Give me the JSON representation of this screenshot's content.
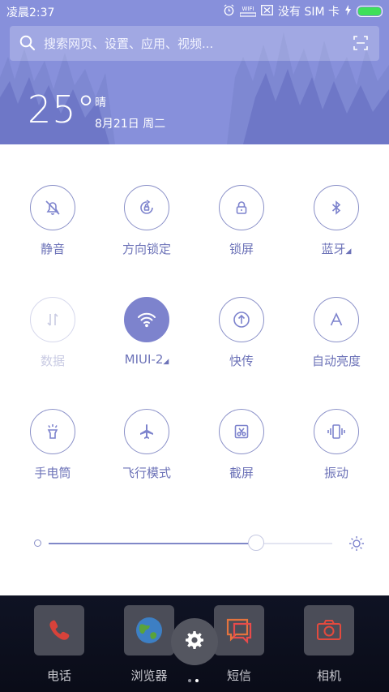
{
  "status_bar": {
    "time": "凌晨2:37",
    "wifi_label": "WIFI",
    "sim_text": "没有 SIM 卡"
  },
  "search": {
    "placeholder": "搜索网页、设置、应用、视频..."
  },
  "weather": {
    "temperature": "25°",
    "condition": "晴",
    "date": "8月21日 周二"
  },
  "toggles": [
    {
      "label": "静音",
      "icon": "silent-bell-icon",
      "state": "off"
    },
    {
      "label": "方向锁定",
      "icon": "rotation-lock-icon",
      "state": "off"
    },
    {
      "label": "锁屏",
      "icon": "lock-icon",
      "state": "off"
    },
    {
      "label": "蓝牙",
      "icon": "bluetooth-icon",
      "state": "off"
    },
    {
      "label": "数据",
      "icon": "mobile-data-icon",
      "state": "disabled"
    },
    {
      "label": "MIUI-2",
      "icon": "wifi-icon",
      "state": "on"
    },
    {
      "label": "快传",
      "icon": "quick-transfer-icon",
      "state": "off"
    },
    {
      "label": "自动亮度",
      "icon": "auto-brightness-icon",
      "state": "off"
    },
    {
      "label": "手电筒",
      "icon": "flashlight-icon",
      "state": "off"
    },
    {
      "label": "飞行模式",
      "icon": "airplane-icon",
      "state": "off"
    },
    {
      "label": "截屏",
      "icon": "screenshot-icon",
      "state": "off"
    },
    {
      "label": "振动",
      "icon": "vibrate-icon",
      "state": "off"
    }
  ],
  "brightness": {
    "level": 0.73
  },
  "dock": [
    {
      "label": "电话",
      "icon": "phone-icon"
    },
    {
      "label": "浏览器",
      "icon": "browser-icon"
    },
    {
      "label": "短信",
      "icon": "messages-icon"
    },
    {
      "label": "相机",
      "icon": "camera-icon"
    }
  ],
  "colors": {
    "accent": "#7d83cd",
    "header": "#7f86d6",
    "panel": "#ffffff"
  }
}
